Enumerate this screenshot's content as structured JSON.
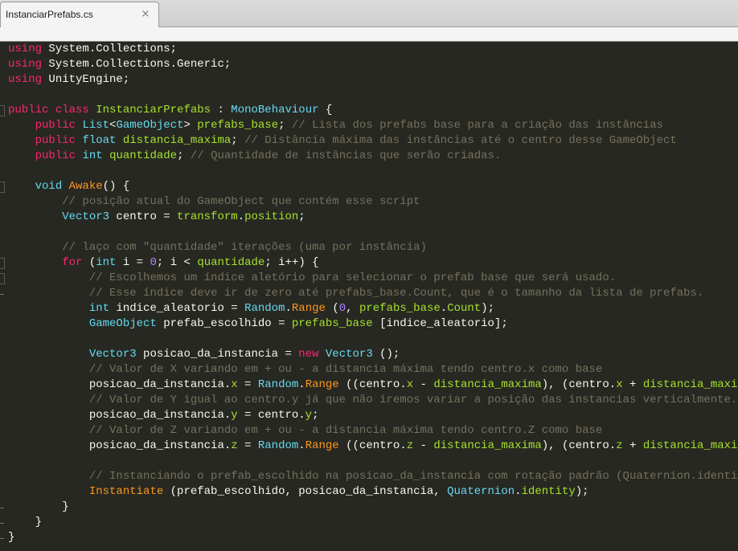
{
  "tab": {
    "title": "InstanciarPrefabs.cs",
    "close_glyph": "×"
  },
  "colors": {
    "background": "#272822",
    "keyword": "#f92672",
    "type": "#66d9ef",
    "identifier": "#a6e22e",
    "function": "#fd971f",
    "number": "#ae81ff",
    "comment": "#75715e",
    "text": "#f8f8f2"
  },
  "code": {
    "lines": [
      [
        [
          "kw",
          "using"
        ],
        [
          "pl",
          " System.Collections;"
        ]
      ],
      [
        [
          "kw",
          "using"
        ],
        [
          "pl",
          " System.Collections.Generic;"
        ]
      ],
      [
        [
          "kw",
          "using"
        ],
        [
          "pl",
          " UnityEngine;"
        ]
      ],
      [],
      [
        [
          "kw",
          "public"
        ],
        [
          "pl",
          " "
        ],
        [
          "kw",
          "class"
        ],
        [
          "pl",
          " "
        ],
        [
          "cls",
          "InstanciarPrefabs"
        ],
        [
          "pl",
          " : "
        ],
        [
          "ty",
          "MonoBehaviour"
        ],
        [
          "pl",
          " {"
        ]
      ],
      [
        [
          "pl",
          "    "
        ],
        [
          "kw",
          "public"
        ],
        [
          "pl",
          " "
        ],
        [
          "ty",
          "List"
        ],
        [
          "pl",
          "<"
        ],
        [
          "ty",
          "GameObject"
        ],
        [
          "pl",
          "> "
        ],
        [
          "var",
          "prefabs_base"
        ],
        [
          "pl",
          "; "
        ],
        [
          "cm",
          "// Lista dos prefabs base para a criação das instâncias"
        ]
      ],
      [
        [
          "pl",
          "    "
        ],
        [
          "kw",
          "public"
        ],
        [
          "pl",
          " "
        ],
        [
          "ty",
          "float"
        ],
        [
          "pl",
          " "
        ],
        [
          "var",
          "distancia_maxima"
        ],
        [
          "pl",
          "; "
        ],
        [
          "cm",
          "// Distância máxima das instâncias até o centro desse GameObject"
        ]
      ],
      [
        [
          "pl",
          "    "
        ],
        [
          "kw",
          "public"
        ],
        [
          "pl",
          " "
        ],
        [
          "ty",
          "int"
        ],
        [
          "pl",
          " "
        ],
        [
          "var",
          "quantidade"
        ],
        [
          "pl",
          "; "
        ],
        [
          "cm",
          "// Quantidade de instâncias que serão criadas."
        ]
      ],
      [],
      [
        [
          "pl",
          "    "
        ],
        [
          "ty",
          "void"
        ],
        [
          "pl",
          " "
        ],
        [
          "fn",
          "Awake"
        ],
        [
          "pl",
          "() {"
        ]
      ],
      [
        [
          "pl",
          "        "
        ],
        [
          "cm",
          "// posição atual do GameObject que contém esse script"
        ]
      ],
      [
        [
          "pl",
          "        "
        ],
        [
          "ty",
          "Vector3"
        ],
        [
          "pl",
          " centro = "
        ],
        [
          "var",
          "transform"
        ],
        [
          "pl",
          "."
        ],
        [
          "var",
          "position"
        ],
        [
          "pl",
          ";"
        ]
      ],
      [],
      [
        [
          "pl",
          "        "
        ],
        [
          "cm",
          "// laço com \"quantidade\" iterações (uma por instância)"
        ]
      ],
      [
        [
          "pl",
          "        "
        ],
        [
          "kw",
          "for"
        ],
        [
          "pl",
          " ("
        ],
        [
          "ty",
          "int"
        ],
        [
          "pl",
          " i = "
        ],
        [
          "num",
          "0"
        ],
        [
          "pl",
          "; i < "
        ],
        [
          "var",
          "quantidade"
        ],
        [
          "pl",
          "; i++) {"
        ]
      ],
      [
        [
          "pl",
          "            "
        ],
        [
          "cm",
          "// Escolhemos um índice aletório para selecionar o prefab base que será usado."
        ]
      ],
      [
        [
          "pl",
          "            "
        ],
        [
          "cm",
          "// Esse índice deve ir de zero até prefabs_base.Count, que é o tamanho da lista de prefabs."
        ]
      ],
      [
        [
          "pl",
          "            "
        ],
        [
          "ty",
          "int"
        ],
        [
          "pl",
          " indice_aleatorio = "
        ],
        [
          "ty",
          "Random"
        ],
        [
          "pl",
          "."
        ],
        [
          "fn",
          "Range"
        ],
        [
          "pl",
          " ("
        ],
        [
          "num",
          "0"
        ],
        [
          "pl",
          ", "
        ],
        [
          "var",
          "prefabs_base"
        ],
        [
          "pl",
          "."
        ],
        [
          "var",
          "Count"
        ],
        [
          "pl",
          ");"
        ]
      ],
      [
        [
          "pl",
          "            "
        ],
        [
          "ty",
          "GameObject"
        ],
        [
          "pl",
          " prefab_escolhido = "
        ],
        [
          "var",
          "prefabs_base"
        ],
        [
          "pl",
          " [indice_aleatorio];"
        ]
      ],
      [],
      [
        [
          "pl",
          "            "
        ],
        [
          "ty",
          "Vector3"
        ],
        [
          "pl",
          " posicao_da_instancia = "
        ],
        [
          "kw",
          "new"
        ],
        [
          "pl",
          " "
        ],
        [
          "ty",
          "Vector3"
        ],
        [
          "pl",
          " ();"
        ]
      ],
      [
        [
          "pl",
          "            "
        ],
        [
          "cm",
          "// Valor de X variando em + ou - a distancia máxima tendo centro.x como base"
        ]
      ],
      [
        [
          "pl",
          "            posicao_da_instancia."
        ],
        [
          "var",
          "x"
        ],
        [
          "pl",
          " = "
        ],
        [
          "ty",
          "Random"
        ],
        [
          "pl",
          "."
        ],
        [
          "fn",
          "Range"
        ],
        [
          "pl",
          " ((centro."
        ],
        [
          "var",
          "x"
        ],
        [
          "pl",
          " - "
        ],
        [
          "var",
          "distancia_maxima"
        ],
        [
          "pl",
          "), (centro."
        ],
        [
          "var",
          "x"
        ],
        [
          "pl",
          " + "
        ],
        [
          "var",
          "distancia_maxima"
        ],
        [
          "pl",
          "));"
        ]
      ],
      [
        [
          "pl",
          "            "
        ],
        [
          "cm",
          "// Valor de Y igual ao centro.y já que não iremos variar a posição das instancias verticalmente."
        ]
      ],
      [
        [
          "pl",
          "            posicao_da_instancia."
        ],
        [
          "var",
          "y"
        ],
        [
          "pl",
          " = centro."
        ],
        [
          "var",
          "y"
        ],
        [
          "pl",
          ";"
        ]
      ],
      [
        [
          "pl",
          "            "
        ],
        [
          "cm",
          "// Valor de Z variando em + ou - a distancia máxima tendo centro.Z como base"
        ]
      ],
      [
        [
          "pl",
          "            posicao_da_instancia."
        ],
        [
          "var",
          "z"
        ],
        [
          "pl",
          " = "
        ],
        [
          "ty",
          "Random"
        ],
        [
          "pl",
          "."
        ],
        [
          "fn",
          "Range"
        ],
        [
          "pl",
          " ((centro."
        ],
        [
          "var",
          "z"
        ],
        [
          "pl",
          " - "
        ],
        [
          "var",
          "distancia_maxima"
        ],
        [
          "pl",
          "), (centro."
        ],
        [
          "var",
          "z"
        ],
        [
          "pl",
          " + "
        ],
        [
          "var",
          "distancia_maxima"
        ],
        [
          "pl",
          "));"
        ]
      ],
      [],
      [
        [
          "pl",
          "            "
        ],
        [
          "cm",
          "// Instanciando o prefab_escolhido na posicao_da_instancia com rotação padrão (Quaternion.identity)"
        ]
      ],
      [
        [
          "pl",
          "            "
        ],
        [
          "fn",
          "Instantiate"
        ],
        [
          "pl",
          " (prefab_escolhido, posicao_da_instancia, "
        ],
        [
          "ty",
          "Quaternion"
        ],
        [
          "pl",
          "."
        ],
        [
          "var",
          "identity"
        ],
        [
          "pl",
          ");"
        ]
      ],
      [
        [
          "pl",
          "        }"
        ]
      ],
      [
        [
          "pl",
          "    }"
        ]
      ],
      [
        [
          "pl",
          "}"
        ]
      ]
    ]
  }
}
